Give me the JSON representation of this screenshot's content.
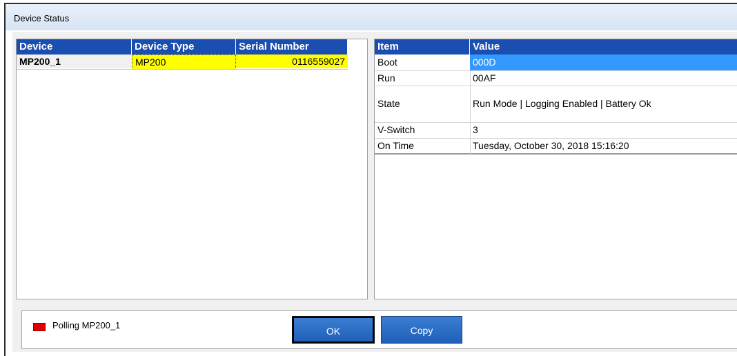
{
  "window": {
    "title": "Device Status"
  },
  "device_table": {
    "columns": [
      "Device",
      "Device Type",
      "Serial Number"
    ],
    "rows": [
      {
        "device": "MP200_1",
        "type": "MP200",
        "serial": "0116559027"
      }
    ]
  },
  "detail_table": {
    "columns": [
      "Item",
      "Value"
    ],
    "rows": [
      {
        "item": "Boot",
        "value": "000D"
      },
      {
        "item": "Run",
        "value": "00AF"
      },
      {
        "item": "State",
        "value": "Run Mode | Logging Enabled | Battery Ok"
      },
      {
        "item": "V-Switch",
        "value": "3"
      },
      {
        "item": "On Time",
        "value": "Tuesday, October 30, 2018 15:16:20"
      }
    ]
  },
  "status": {
    "text": "Polling MP200_1",
    "indicator_color": "#e00000"
  },
  "buttons": {
    "ok": "OK",
    "copy": "Copy"
  },
  "colors": {
    "header": "#1a4eb0",
    "selected_row": "#3399ff",
    "highlight": "#ffff00"
  }
}
